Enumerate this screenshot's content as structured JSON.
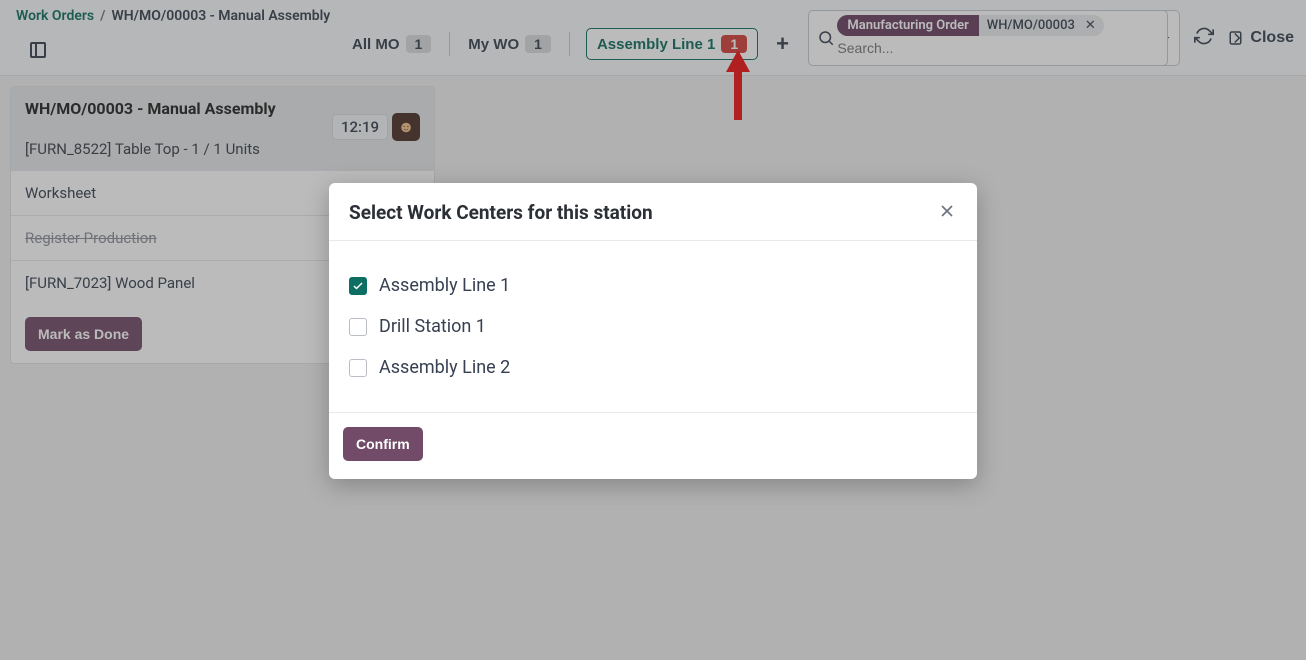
{
  "breadcrumb": {
    "root": "Work Orders",
    "current": "WH/MO/00003 - Manual Assembly"
  },
  "filters": {
    "all_mo_label": "All MO",
    "all_mo_count": "1",
    "my_wo_label": "My WO",
    "my_wo_count": "1",
    "tab_label": "Assembly Line 1",
    "tab_count": "1"
  },
  "search": {
    "chip_tag": "Manufacturing Order",
    "chip_value": "WH/MO/00003",
    "placeholder": "Search..."
  },
  "actions": {
    "close": "Close"
  },
  "card": {
    "title": "WH/MO/00003 - Manual Assembly",
    "subtitle": "[FURN_8522] Table Top - 1 / 1 Units",
    "timer": "12:19",
    "items": {
      "worksheet": "Worksheet",
      "register": "Register Production",
      "panel": "[FURN_7023] Wood Panel"
    },
    "mark_done": "Mark as Done"
  },
  "modal": {
    "title": "Select Work Centers for this station",
    "options": [
      {
        "label": "Assembly Line 1",
        "checked": true
      },
      {
        "label": "Drill Station 1",
        "checked": false
      },
      {
        "label": "Assembly Line 2",
        "checked": false
      }
    ],
    "confirm": "Confirm"
  }
}
